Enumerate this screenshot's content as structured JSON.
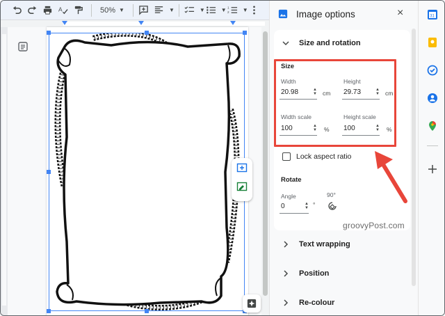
{
  "toolbar": {
    "zoom": "50%"
  },
  "panel": {
    "title": "Image options",
    "close": "×",
    "sections": {
      "size_rotation": "Size and rotation",
      "text_wrapping": "Text wrapping",
      "position": "Position",
      "recolour": "Re-colour"
    },
    "size": {
      "label": "Size",
      "width_label": "Width",
      "width_value": "20.98",
      "width_unit": "cm",
      "height_label": "Height",
      "height_value": "29.73",
      "height_unit": "cm",
      "width_scale_label": "Width scale",
      "width_scale_value": "100",
      "width_scale_unit": "%",
      "height_scale_label": "Height scale",
      "height_scale_value": "100",
      "height_scale_unit": "%"
    },
    "lock_aspect": "Lock aspect ratio",
    "rotate": {
      "label": "Rotate",
      "angle_label": "Angle",
      "angle_value": "0",
      "angle_unit": "°",
      "ninety_label": "90°"
    }
  },
  "watermark": "groovyPost.com",
  "colors": {
    "accent": "#4285f4",
    "highlight": "#e8463a"
  }
}
